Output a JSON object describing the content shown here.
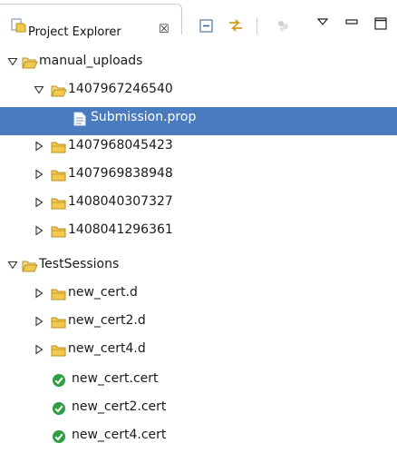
{
  "view": {
    "title": "Project Explorer",
    "close_glyph": "☒",
    "toolbar": [
      {
        "name": "collapse-all-icon"
      },
      {
        "name": "link-with-editor-icon"
      },
      {
        "name": "disabled-action-icon"
      },
      {
        "name": "view-menu-icon"
      },
      {
        "name": "minimize-icon"
      },
      {
        "name": "maximize-icon"
      }
    ]
  },
  "tree": {
    "manual_uploads": {
      "label": "manual_uploads",
      "expanded": true,
      "icon": "open-folder-icon"
    },
    "item_1407967246540": {
      "label": "1407967246540",
      "expanded": true,
      "icon": "open-folder-icon"
    },
    "submission": {
      "label": "Submission.prop",
      "selected": true,
      "icon": "file-icon"
    },
    "item_1407968045423": {
      "label": "1407968045423",
      "expanded": false,
      "icon": "folder-icon"
    },
    "item_1407969838948": {
      "label": "1407969838948",
      "expanded": false,
      "icon": "folder-icon"
    },
    "item_1408040307327": {
      "label": "1408040307327",
      "expanded": false,
      "icon": "folder-icon"
    },
    "item_1408041296361": {
      "label": "1408041296361",
      "expanded": false,
      "icon": "folder-icon"
    },
    "test_sessions": {
      "label": "TestSessions",
      "expanded": true,
      "icon": "open-folder-icon"
    },
    "new_cert_d": {
      "label": "new_cert.d",
      "expanded": false,
      "icon": "folder-icon"
    },
    "new_cert2_d": {
      "label": "new_cert2.d",
      "expanded": false,
      "icon": "folder-icon"
    },
    "new_cert4_d": {
      "label": "new_cert4.d",
      "expanded": false,
      "icon": "folder-icon"
    },
    "new_cert_cert": {
      "label": "new_cert.cert",
      "icon": "check-circle-icon"
    },
    "new_cert2_cert": {
      "label": "new_cert2.cert",
      "icon": "check-circle-icon"
    },
    "new_cert4_cert": {
      "label": "new_cert4.cert",
      "icon": "check-circle-icon"
    }
  },
  "colors": {
    "selection": "#4a7bbf",
    "folder": "#f2c94c",
    "check": "#2f9e44"
  }
}
